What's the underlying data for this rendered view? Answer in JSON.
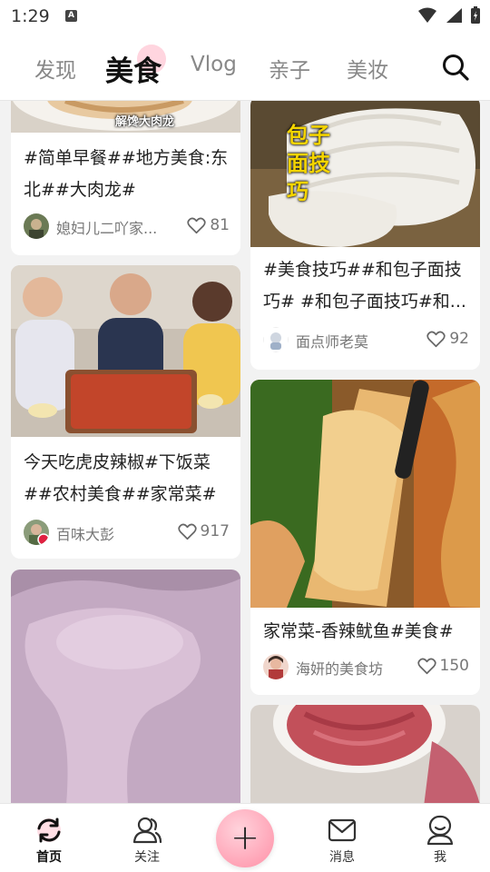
{
  "status_bar": {
    "time": "1:29",
    "notification_letter": "A"
  },
  "tabs": [
    {
      "label": "发现",
      "active": false
    },
    {
      "label": "美食",
      "active": true
    },
    {
      "label": "Vlog",
      "active": false
    },
    {
      "label": "亲子",
      "active": false
    },
    {
      "label": "美妆",
      "active": false
    }
  ],
  "feed": {
    "left": [
      {
        "image_caption": "解馋大肉龙",
        "title": "#简单早餐##地方美食:东北##大肉龙#",
        "author": "媳妇儿二吖家...",
        "likes": "81"
      },
      {
        "title": "今天吃虎皮辣椒#下饭菜##农村美食##家常菜#",
        "author": "百味大彭",
        "likes": "917"
      },
      {
        "title": "",
        "author": "",
        "likes": ""
      }
    ],
    "right": [
      {
        "image_caption": "包子面技巧",
        "title": "#美食技巧##和包子面技巧# #和包子面技巧#和...",
        "author": "面点师老莫",
        "likes": "92"
      },
      {
        "title": "家常菜-香辣鱿鱼#美食#",
        "author": "海妍的美食坊",
        "likes": "150"
      },
      {
        "title": "",
        "author": "",
        "likes": ""
      }
    ]
  },
  "bottom_nav": [
    {
      "label": "首页",
      "icon": "refresh-icon",
      "active": true
    },
    {
      "label": "关注",
      "icon": "people-icon",
      "active": false
    },
    {
      "label": "+",
      "icon": "plus-icon",
      "active": false
    },
    {
      "label": "消息",
      "icon": "mail-icon",
      "active": false
    },
    {
      "label": "我",
      "icon": "person-icon",
      "active": false
    }
  ],
  "colors": {
    "accent": "#ff8fa6",
    "background": "#f2f2f2"
  }
}
